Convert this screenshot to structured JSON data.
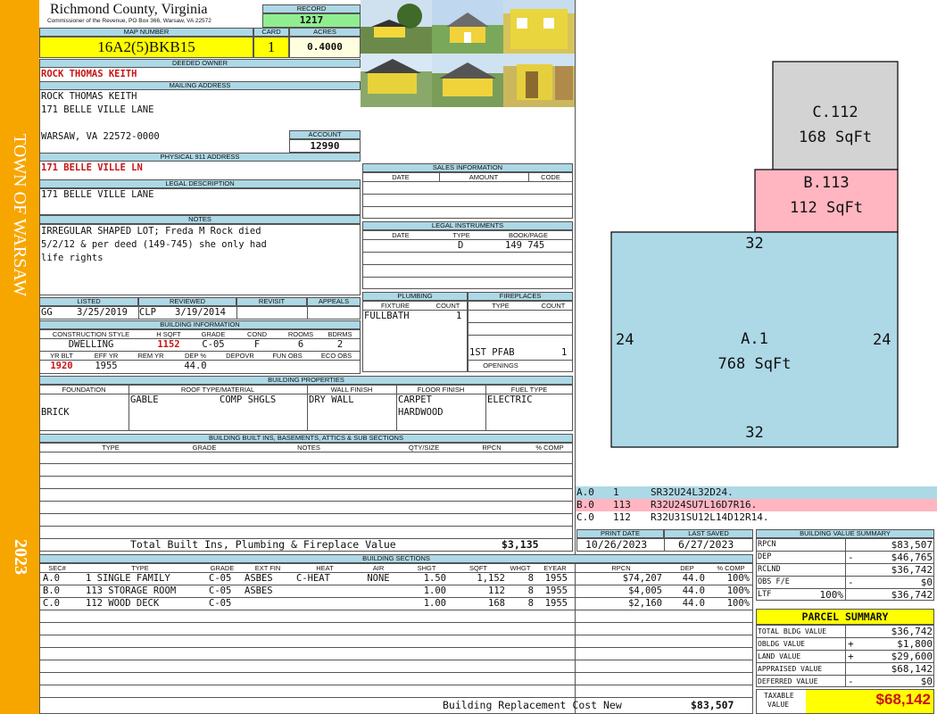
{
  "sidebar": {
    "town": "TOWN OF WARSAW",
    "year": "2023"
  },
  "header": {
    "county": "Richmond County, Virginia",
    "commissioner": "Commissioner of the Revenue, PO Box 366, Warsaw, VA 22572"
  },
  "record": {
    "label": "RECORD",
    "value": "1217"
  },
  "map": {
    "label": "MAP NUMBER",
    "value": "16A2(5)BKB15"
  },
  "card": {
    "label": "CARD",
    "value": "1"
  },
  "acres": {
    "label": "ACRES",
    "value": "0.4000"
  },
  "owner": {
    "label": "DEEDED OWNER",
    "value": "ROCK THOMAS KEITH"
  },
  "mailing": {
    "label": "MAILING ADDRESS",
    "line1": "ROCK THOMAS KEITH",
    "line2": "171 BELLE VILLE LANE",
    "line3": "WARSAW, VA 22572-0000"
  },
  "account": {
    "label": "ACCOUNT",
    "value": "12990"
  },
  "physical": {
    "label": "PHYSICAL 911 ADDRESS",
    "value": "171 BELLE VILLE LN"
  },
  "legal": {
    "label": "LEGAL DESCRIPTION",
    "value": "171 BELLE VILLE LANE"
  },
  "notes": {
    "label": "NOTES",
    "line1": "IRREGULAR SHAPED LOT; Freda M Rock died",
    "line2": "5/2/12 & per deed (149-745) she only had",
    "line3": "life rights"
  },
  "sales": {
    "label": "SALES INFORMATION",
    "cols": [
      "DATE",
      "AMOUNT",
      "CODE"
    ]
  },
  "instruments": {
    "label": "LEGAL INSTRUMENTS",
    "cols": [
      "DATE",
      "TYPE",
      "BOOK/PAGE"
    ],
    "type": "D",
    "bookpage": "149 745"
  },
  "listed": {
    "listed_label": "LISTED",
    "reviewed_label": "REVIEWED",
    "revisit_label": "REVISIT",
    "appeals_label": "APPEALS",
    "listed_by": "GG",
    "listed_date": "3/25/2019",
    "reviewed_by": "CLP",
    "reviewed_date": "3/19/2014"
  },
  "plumbing": {
    "label": "PLUMBING",
    "cols": [
      "FIXTURE",
      "COUNT"
    ],
    "fixture": "FULLBATH",
    "count": "1"
  },
  "fireplaces": {
    "label": "FIREPLACES",
    "cols": [
      "TYPE",
      "COUNT"
    ],
    "type": "1ST PFAB",
    "count": "1",
    "openings": "OPENINGS"
  },
  "building": {
    "label": "BUILDING INFORMATION",
    "cols": [
      "CONSTRUCTION STYLE",
      "H SQFT",
      "GRADE",
      "COND",
      "ROOMS",
      "BDRMS"
    ],
    "style": "DWELLING",
    "hsqft": "1152",
    "grade": "C-05",
    "cond": "F",
    "rooms": "6",
    "bdrms": "2",
    "cols2": [
      "YR BLT",
      "EFF YR",
      "REM YR",
      "DEP %",
      "DEPOVR",
      "FUN OBS",
      "ECO OBS"
    ],
    "yrblt": "1920",
    "effyr": "1955",
    "dep": "44.0"
  },
  "props": {
    "label": "BUILDING PROPERTIES",
    "cols": [
      "FOUNDATION",
      "ROOF TYPE/MATERIAL",
      "WALL FINISH",
      "FLOOR FINISH",
      "FUEL TYPE"
    ],
    "foundation": "BRICK",
    "roof_type": "GABLE",
    "roof_mat": "COMP SHGLS",
    "wall": "DRY WALL",
    "floor1": "CARPET",
    "floor2": "HARDWOOD",
    "fuel": "ELECTRIC"
  },
  "builtins": {
    "label": "BUILDING BUILT INS, BASEMENTS, ATTICS & SUB SECTIONS",
    "cols": [
      "TYPE",
      "GRADE",
      "NOTES",
      "QTY/SIZE",
      "RPCN",
      "% COMP"
    ],
    "total_label": "Total Built Ins, Plumbing & Fireplace Value",
    "total": "$3,135"
  },
  "sketch": {
    "sections": [
      {
        "code": "C.112",
        "area": "168 SqFt"
      },
      {
        "code": "B.113",
        "area": "112 SqFt"
      },
      {
        "code": "A.1",
        "area": "768 SqFt"
      }
    ],
    "dims": {
      "top": "32",
      "bottom": "32",
      "left": "24",
      "right": "24"
    },
    "legend": [
      {
        "sec": "A.0",
        "num": "1",
        "desc": "SR32U24L32D24."
      },
      {
        "sec": "B.0",
        "num": "113",
        "desc": "R32U24SU7L16D7R16."
      },
      {
        "sec": "C.0",
        "num": "112",
        "desc": "R32U31SU12L14D12R14."
      }
    ],
    "colors": {
      "a": "#add8e6",
      "b": "#ffb6c1",
      "c": "#d3d3d3"
    }
  },
  "dates": {
    "print_label": "PRINT DATE",
    "print": "10/26/2023",
    "saved_label": "LAST SAVED",
    "saved": "6/27/2023"
  },
  "sections": {
    "label": "BUILDING SECTIONS",
    "cols": [
      "SEC#",
      "TYPE",
      "GRADE",
      "EXT FIN",
      "HEAT",
      "AIR",
      "SHGT",
      "SQFT",
      "WHGT",
      "EYEAR",
      "RPCN",
      "DEP",
      "% COMP"
    ],
    "rows": [
      {
        "sec": "A.0",
        "type": "1 SINGLE FAMILY",
        "grade": "C-05",
        "ext": "ASBES",
        "heat": "C-HEAT",
        "air": "NONE",
        "shgt": "1.50",
        "sqft": "1,152",
        "whgt": "8",
        "eyear": "1955",
        "rpcn": "$74,207",
        "dep": "44.0",
        "comp": "100%"
      },
      {
        "sec": "B.0",
        "type": "113 STORAGE ROOM",
        "grade": "C-05",
        "ext": "ASBES",
        "heat": "",
        "air": "",
        "shgt": "1.00",
        "sqft": "112",
        "whgt": "8",
        "eyear": "1955",
        "rpcn": "$4,005",
        "dep": "44.0",
        "comp": "100%"
      },
      {
        "sec": "C.0",
        "type": "112 WOOD DECK",
        "grade": "C-05",
        "ext": "",
        "heat": "",
        "air": "",
        "shgt": "1.00",
        "sqft": "168",
        "whgt": "8",
        "eyear": "1955",
        "rpcn": "$2,160",
        "dep": "44.0",
        "comp": "100%"
      }
    ],
    "replacement_label": "Building Replacement Cost New",
    "replacement": "$83,507"
  },
  "bvs": {
    "label": "BUILDING VALUE SUMMARY",
    "rows": [
      {
        "label": "RPCN",
        "sign": "",
        "value": "$83,507"
      },
      {
        "label": "DEP",
        "sign": "-",
        "value": "$46,765"
      },
      {
        "label": "RCLND",
        "sign": "",
        "value": "$36,742"
      },
      {
        "label": "OBS F/E",
        "sign": "-",
        "value": "$0"
      },
      {
        "label": "LTF",
        "pct": "100%",
        "sign": "",
        "value": "$36,742"
      }
    ]
  },
  "parcel": {
    "label": "PARCEL SUMMARY",
    "rows": [
      {
        "label": "TOTAL BLDG VALUE",
        "sign": "",
        "value": "$36,742"
      },
      {
        "label": "OBLDG VALUE",
        "sign": "+",
        "value": "$1,800"
      },
      {
        "label": "LAND VALUE",
        "sign": "+",
        "value": "$29,600"
      },
      {
        "label": "APPRAISED VALUE",
        "sign": "",
        "value": "$68,142"
      },
      {
        "label": "DEFERRED VALUE",
        "sign": "-",
        "value": "$0"
      }
    ],
    "taxable_label1": "TAXABLE",
    "taxable_label2": "VALUE",
    "taxable": "$68,142"
  }
}
